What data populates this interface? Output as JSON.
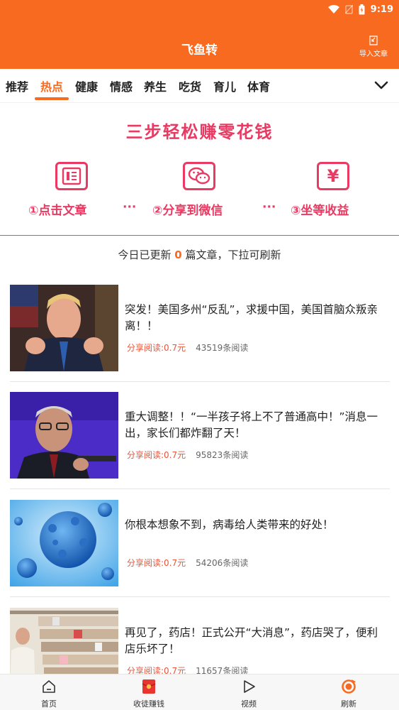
{
  "status_bar": {
    "time": "9:19"
  },
  "header": {
    "title": "飞鱼转",
    "import_label": "导入文章"
  },
  "tabs": [
    {
      "label": "推荐",
      "active": false
    },
    {
      "label": "热点",
      "active": true
    },
    {
      "label": "健康",
      "active": false
    },
    {
      "label": "情感",
      "active": false
    },
    {
      "label": "养生",
      "active": false
    },
    {
      "label": "吃货",
      "active": false
    },
    {
      "label": "育儿",
      "active": false
    },
    {
      "label": "体育",
      "active": false
    }
  ],
  "banner": {
    "title": "三步轻松赚零花钱",
    "steps": [
      {
        "label": "①点击文章",
        "icon": "article-icon"
      },
      {
        "label": "②分享到微信",
        "icon": "wechat-icon"
      },
      {
        "label": "③坐等收益",
        "icon": "yuan-icon"
      }
    ],
    "separator": "···",
    "yuan_symbol": "¥"
  },
  "refresh_hint": {
    "before": "今日已更新 ",
    "count": "0",
    "after": " 篇文章，下拉可刷新"
  },
  "articles": [
    {
      "title": "突发！美国多州“反乱”，求援中国，美国首脑众叛亲离！！",
      "share": "分享阅读:0.7元",
      "reads": "43519条阅读"
    },
    {
      "title": "重大调整！！“一半孩子将上不了普通高中！”消息一出，家长们都炸翻了天！",
      "share": "分享阅读:0.7元",
      "reads": "95823条阅读"
    },
    {
      "title": "你根本想象不到，病毒给人类带来的好处！",
      "share": "分享阅读:0.7元",
      "reads": "54206条阅读"
    },
    {
      "title": "再见了，药店！正式公开“大消息”，药店哭了，便利店乐坏了！",
      "share": "分享阅读:0.7元",
      "reads": "11657条阅读"
    }
  ],
  "bottom_nav": [
    {
      "label": "首页",
      "icon": "home-icon"
    },
    {
      "label": "收徒赚钱",
      "icon": "red-envelope-icon"
    },
    {
      "label": "视频",
      "icon": "video-play-icon"
    },
    {
      "label": "刷新",
      "icon": "refresh-icon"
    }
  ],
  "colors": {
    "brand": "#f86a1f",
    "banner_red": "#e83a62",
    "share_red": "#e8563b"
  }
}
